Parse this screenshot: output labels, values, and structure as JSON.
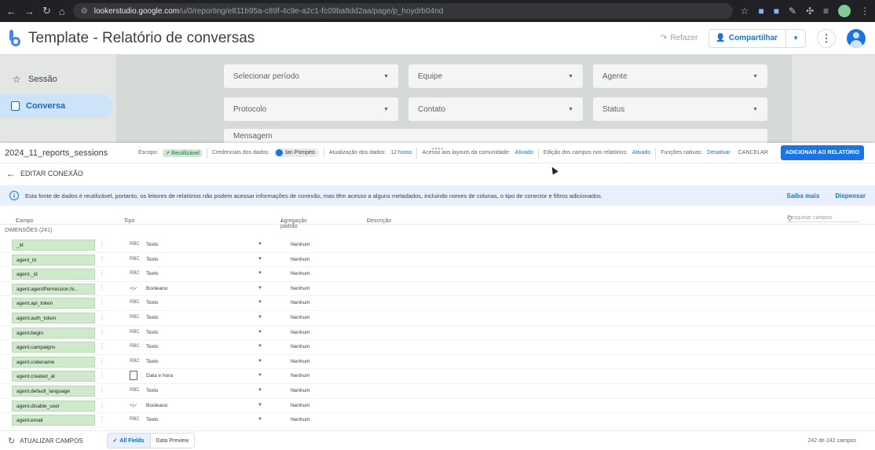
{
  "browser": {
    "url_host": "lookerstudio.google.com",
    "url_path": "/u/0/reporting/e811b95a-c89f-4c9e-a2c1-fc09ba8dd2aa/page/p_hoydrb04nd"
  },
  "header": {
    "title": "Template - Relatório de conversas",
    "redo_label": "Refazer",
    "share_label": "Compartilhar"
  },
  "sidebar": {
    "items": [
      {
        "label": "Sessão"
      },
      {
        "label": "Conversa"
      }
    ]
  },
  "filters": {
    "period": "Selecionar período",
    "team": "Equipe",
    "agent": "Agente",
    "protocol": "Protocolo",
    "contact": "Contato",
    "status": "Status",
    "message": "Mensagem"
  },
  "datasource": {
    "name": "2024_11_reports_sessions",
    "scope_label": "Escopo:",
    "scope_value": "Reutilizável",
    "credentials_label": "Credenciais dos dados:",
    "credentials_user": "Ian Pompeo",
    "freshness_label": "Atualização dos dados:",
    "freshness_value": "12 horas",
    "community_label": "Acesso aos layouts da comunidade:",
    "community_value": "Ativado",
    "edit_fields_label": "Edição dos campos nos relatórios:",
    "edit_fields_value": "Ativado",
    "native_label": "Funções nativas:",
    "native_value": "Desativar",
    "cancel_label": "CANCELAR",
    "add_label": "ADICIONAR AO RELATÓRIO"
  },
  "edit_connection": "EDITAR CONEXÃO",
  "info": {
    "message": "Esta fonte de dados é reutilizável, portanto, os leitores de relatórios não podem acessar informações de conexão, mas têm acesso a alguns metadados, incluindo nomes de colunas, o tipo de conector e filtros adicionados.",
    "learn_more": "Saiba mais",
    "dismiss": "Dispensar"
  },
  "columns": {
    "field": "Campo",
    "type": "Tipo",
    "aggregation": "Agregação padrão",
    "description": "Descrição",
    "search_placeholder": "Pesquisar campos"
  },
  "dimensions_label": "DIMENSÕES (241)",
  "fields": [
    {
      "name": "_id",
      "type_icon": "RBC",
      "type": "Texto",
      "agg": "Nenhum"
    },
    {
      "name": "agent_id",
      "type_icon": "RBC",
      "type": "Texto",
      "agg": "Nenhum"
    },
    {
      "name": "agent._id",
      "type_icon": "RBC",
      "type": "Texto",
      "agg": "Nenhum"
    },
    {
      "name": "agent.agentPermission.hi...",
      "type_icon": "×|✓",
      "type": "Booleano",
      "agg": "Nenhum"
    },
    {
      "name": "agent.api_token",
      "type_icon": "RBC",
      "type": "Texto",
      "agg": "Nenhum"
    },
    {
      "name": "agent.auth_token",
      "type_icon": "RBC",
      "type": "Texto",
      "agg": "Nenhum"
    },
    {
      "name": "agent.begin",
      "type_icon": "RBC",
      "type": "Texto",
      "agg": "Nenhum"
    },
    {
      "name": "agent.campaigns",
      "type_icon": "RBC",
      "type": "Texto",
      "agg": "Nenhum"
    },
    {
      "name": "agent.codename",
      "type_icon": "RBC",
      "type": "Texto",
      "agg": "Nenhum"
    },
    {
      "name": "agent.created_at",
      "type_icon": "calendar",
      "type": "Data e hora",
      "agg": "Nenhum"
    },
    {
      "name": "agent.default_language",
      "type_icon": "RBC",
      "type": "Texto",
      "agg": "Nenhum"
    },
    {
      "name": "agent.disable_user",
      "type_icon": "×|✓",
      "type": "Booleano",
      "agg": "Nenhum"
    },
    {
      "name": "agent.email",
      "type_icon": "RBC",
      "type": "Texto",
      "agg": "Nenhum"
    }
  ],
  "footer": {
    "refresh_label": "ATUALIZAR CAMPOS",
    "all_fields": "All Fields",
    "data_preview": "Data Preview",
    "count": "242 de 242 campos"
  }
}
